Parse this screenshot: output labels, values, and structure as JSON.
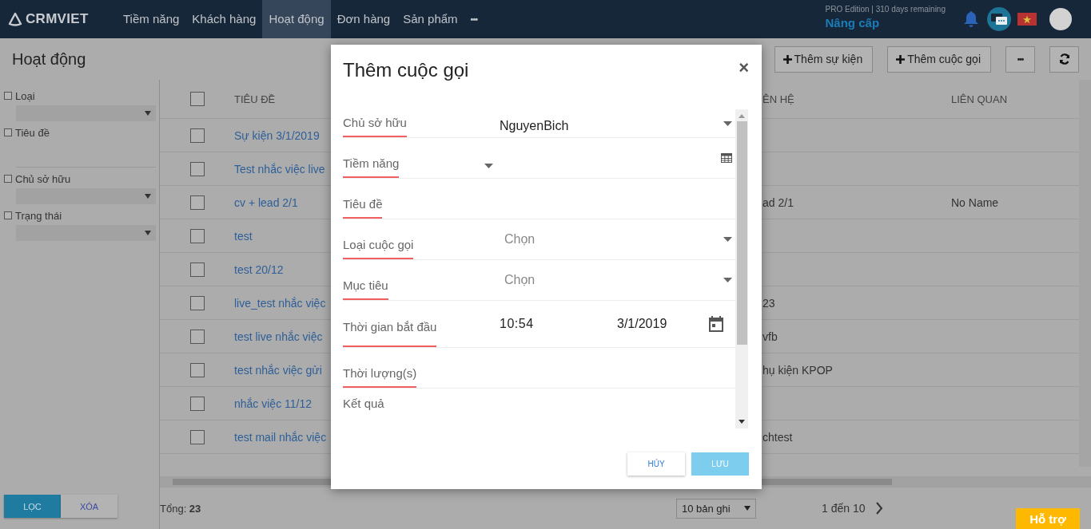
{
  "nav": {
    "logo": "CRMVIET",
    "items": [
      {
        "label": "Tiềm năng",
        "selected": false
      },
      {
        "label": "Khách hàng",
        "selected": false
      },
      {
        "label": "Hoạt động",
        "selected": true
      },
      {
        "label": "Đơn hàng",
        "selected": false
      },
      {
        "label": "Sản phẩm",
        "selected": false
      }
    ],
    "more": "•••",
    "edition": "PRO Edition | 310 days remaining",
    "upgrade": "Nâng cấp"
  },
  "page": {
    "title": "Hoạt động",
    "actions": [
      {
        "kind": "add",
        "label": "Thêm sự kiện"
      },
      {
        "kind": "add",
        "label": "Thêm cuộc gọi"
      },
      {
        "kind": "more",
        "label": "•••"
      },
      {
        "kind": "refresh"
      }
    ]
  },
  "filters": [
    {
      "kind": "select",
      "label": "Loại",
      "checked": false
    },
    {
      "kind": "text",
      "label": "Tiêu đề",
      "checked": false
    },
    {
      "kind": "select",
      "label": "Chủ sở hữu",
      "checked": false
    },
    {
      "kind": "select",
      "label": "Trạng thái",
      "checked": false
    }
  ],
  "filter_buttons": [
    {
      "label": "LỌC",
      "selected": true
    },
    {
      "label": "XÓA",
      "selected": false
    }
  ],
  "table": {
    "all_checked": false,
    "columns": [
      "TIÊU ĐỀ",
      "ÊN HỆ",
      "LIÊN QUAN"
    ],
    "rows": [
      {
        "checked": false,
        "title": "Sự kiện 3/1/2019"
      },
      {
        "checked": false,
        "title": "Test nhắc việc live"
      },
      {
        "checked": false,
        "title": "cv + lead 2/1",
        "contact": "ad 2/1",
        "related": "No Name"
      },
      {
        "checked": false,
        "title": "test"
      },
      {
        "checked": false,
        "title": "test 20/12"
      },
      {
        "checked": false,
        "title": "live_test nhắc việc",
        "contact": "23"
      },
      {
        "checked": false,
        "title": "test live nhắc việc",
        "contact": "vfb"
      },
      {
        "checked": false,
        "title": "test nhắc việc gửi",
        "contact": "hụ kiện KPOP"
      },
      {
        "checked": false,
        "title": "nhắc việc 11/12"
      },
      {
        "checked": false,
        "title": "test mail nhắc việc",
        "contact": "chtest"
      }
    ]
  },
  "footer": {
    "total": "Tổng: **23**",
    "page_size": "10 bản ghi",
    "range": "1 đến 10",
    "support": "Hỗ trợ"
  },
  "dialog": {
    "title": "Thêm cuộc gọi",
    "close": "×",
    "fields": [
      {
        "kind": "select",
        "label": "Chủ sở hữu",
        "value": "NguyenBich"
      },
      {
        "kind": "lookup",
        "label": "Tiềm năng"
      },
      {
        "kind": "text",
        "label": "Tiêu đề"
      },
      {
        "kind": "select",
        "label": "Loại cuộc gọi",
        "placeholder": "Chọn"
      },
      {
        "kind": "select",
        "label": "Mục tiêu",
        "placeholder": "Chọn"
      },
      {
        "kind": "datetime",
        "label": "Thời gian bắt đầu",
        "time": "10:54",
        "date": "3/1/2019"
      },
      {
        "kind": "text",
        "label": "Thời lượng(s)"
      },
      {
        "kind": "textarea",
        "label": "Kết quả"
      }
    ],
    "buttons": [
      {
        "kind": "secondary",
        "label": "HỦY"
      },
      {
        "kind": "primary",
        "label": "LƯU",
        "disabled": true
      }
    ]
  }
}
